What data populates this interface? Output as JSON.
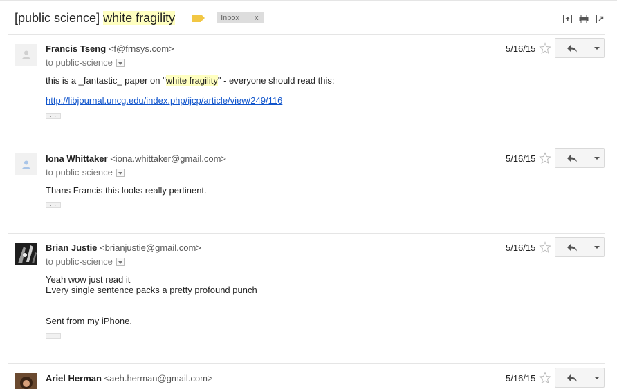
{
  "thread": {
    "subject_prefix": "[public science] ",
    "subject_highlight": "white fragility",
    "label_chip": "Inbox",
    "label_chip_close": "x"
  },
  "messages": [
    {
      "sender_name": "Francis Tseng",
      "sender_email": "<f@frnsys.com>",
      "to": "to public-science",
      "date": "5/16/15",
      "body_pre": "this is a _fantastic_ paper on \"",
      "body_hl": "white fragility",
      "body_post": "\" - everyone should read this:",
      "link": "http://libjournal.uncg.edu/index.php/ijcp/article/view/249/116",
      "ellipsis": "..."
    },
    {
      "sender_name": "Iona Whittaker",
      "sender_email": "<iona.whittaker@gmail.com>",
      "to": "to public-science",
      "date": "5/16/15",
      "body": "Thans Francis this looks really pertinent.",
      "ellipsis": "..."
    },
    {
      "sender_name": "Brian Justie",
      "sender_email": "<brianjustie@gmail.com>",
      "to": "to public-science",
      "date": "5/16/15",
      "body_line1": "Yeah wow just read it",
      "body_line2": "Every single sentence packs a pretty profound punch",
      "signature": "Sent from my iPhone.",
      "ellipsis": "..."
    },
    {
      "sender_name": "Ariel Herman",
      "sender_email": "<aeh.herman@gmail.com>",
      "date": "5/16/15"
    }
  ],
  "icons": {
    "archive": "archive-icon",
    "print": "print-icon",
    "popout": "new-window-icon",
    "star": "star-outline-icon",
    "reply": "reply-arrow-icon",
    "more": "chevron-down-icon",
    "avatar": "person-silhouette-icon"
  },
  "colors": {
    "highlight": "#ffffc0",
    "link": "#1155cc",
    "label_tag": "#f2c744"
  }
}
